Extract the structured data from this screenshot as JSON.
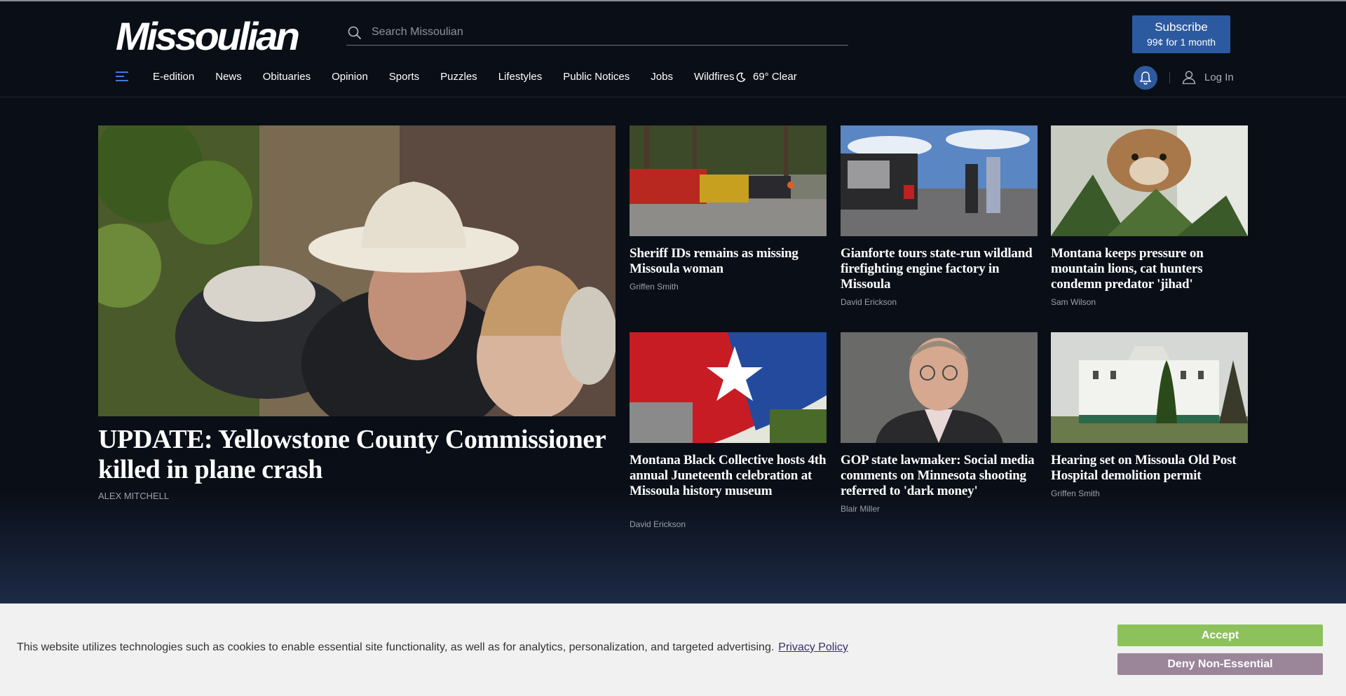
{
  "header": {
    "logo_text": "Missoulian",
    "search_placeholder": "Search Missoulian",
    "subscribe": {
      "label": "Subscribe",
      "offer": "99¢ for 1 month"
    }
  },
  "nav": {
    "items": [
      "E-edition",
      "News",
      "Obituaries",
      "Opinion",
      "Sports",
      "Puzzles",
      "Lifestyles",
      "Public Notices",
      "Jobs",
      "Wildfires"
    ],
    "weather": "69° Clear",
    "login": "Log In"
  },
  "lead_story": {
    "title": "UPDATE: Yellowstone County Commissioner killed in plane crash",
    "author": "ALEX MITCHELL"
  },
  "stories": [
    {
      "title": "Sheriff IDs remains as missing Missoula woman",
      "author": "Griffen Smith"
    },
    {
      "title": "Gianforte tours state-run wildland firefighting engine factory in Missoula",
      "author": "David Erickson"
    },
    {
      "title": "Montana keeps pressure on mountain lions, cat hunters condemn predator 'jihad'",
      "author": "Sam Wilson"
    },
    {
      "title": "Montana Black Collective hosts 4th annual Juneteenth celebration at Missoula history museum",
      "author": "David Erickson"
    },
    {
      "title": "GOP state lawmaker: Social media comments on Minnesota shooting referred to 'dark money'",
      "author": "Blair Miller"
    },
    {
      "title": "Hearing set on Missoula Old Post Hospital demolition permit",
      "author": "Griffen Smith"
    }
  ],
  "cookie_banner": {
    "message": "This website utilizes technologies such as cookies to enable essential site functionality, as well as for analytics, personalization, and targeted advertising.",
    "policy_link": "Privacy Policy",
    "accept": "Accept",
    "deny": "Deny Non-Essential"
  },
  "colors": {
    "brand_blue": "#2c5aa0",
    "accept_green": "#8dc15c",
    "deny_mauve": "#9b8598"
  }
}
